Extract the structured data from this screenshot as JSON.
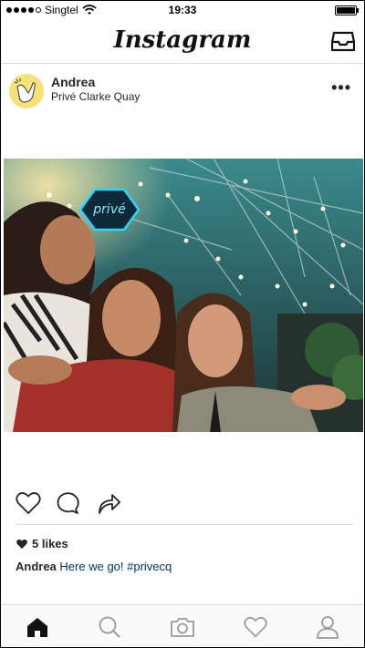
{
  "status_bar": {
    "carrier": "Singtel",
    "time": "19:33"
  },
  "app": {
    "title": "Instagram"
  },
  "post": {
    "username": "Andrea",
    "location": "Privé Clarke Quay",
    "more_label": "•••",
    "photo_sign_text": "privé",
    "likes": "5 likes",
    "caption_user": "Andrea",
    "caption_text": "Here we go! #privecq"
  },
  "icons": {
    "actions": [
      "heart-icon",
      "comment-icon",
      "share-icon"
    ],
    "tabs": [
      "home-icon",
      "search-icon",
      "camera-icon",
      "activity-heart-icon",
      "profile-icon"
    ],
    "header": "inbox-icon"
  }
}
